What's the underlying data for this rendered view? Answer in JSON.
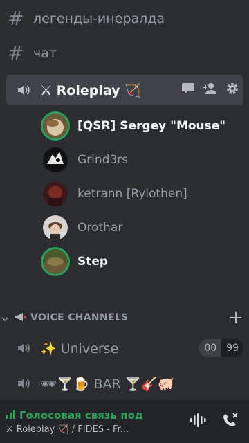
{
  "channels": [
    {
      "icon": "hash-icon",
      "label": "легенды-инералда"
    },
    {
      "icon": "hash-icon",
      "label": "чат"
    }
  ],
  "active_voice": {
    "label": "⚔ Roleplay 🏹",
    "tools": [
      "chat-bubble-icon",
      "add-member-icon",
      "gear-icon"
    ]
  },
  "users": [
    {
      "name": "[QSR] Sergey \"Mouse\"",
      "speaking": true,
      "bright": true
    },
    {
      "name": "Grind3rs",
      "speaking": false,
      "bright": false
    },
    {
      "name": "ketrann [Rylothen]",
      "speaking": false,
      "bright": false
    },
    {
      "name": "Orothar",
      "speaking": false,
      "bright": false
    },
    {
      "name": "Step",
      "speaking": true,
      "bright": true
    }
  ],
  "category": {
    "label": "VOICE CHANNELS",
    "add": "+"
  },
  "voice_channels": [
    {
      "label": "✨ Universe",
      "count_a": "00",
      "count_b": "99"
    },
    {
      "label": "🕶🍸🍺 BAR 🍸🎸🐖"
    }
  ],
  "voice_status": {
    "title": "Голосовая связь под",
    "subtitle": "⚔ Roleplay 🏹 / FIDES - Fr..."
  },
  "colors": {
    "accent_green": "#23a55a",
    "bg": "#2b2d31",
    "active_bg": "#404249"
  }
}
